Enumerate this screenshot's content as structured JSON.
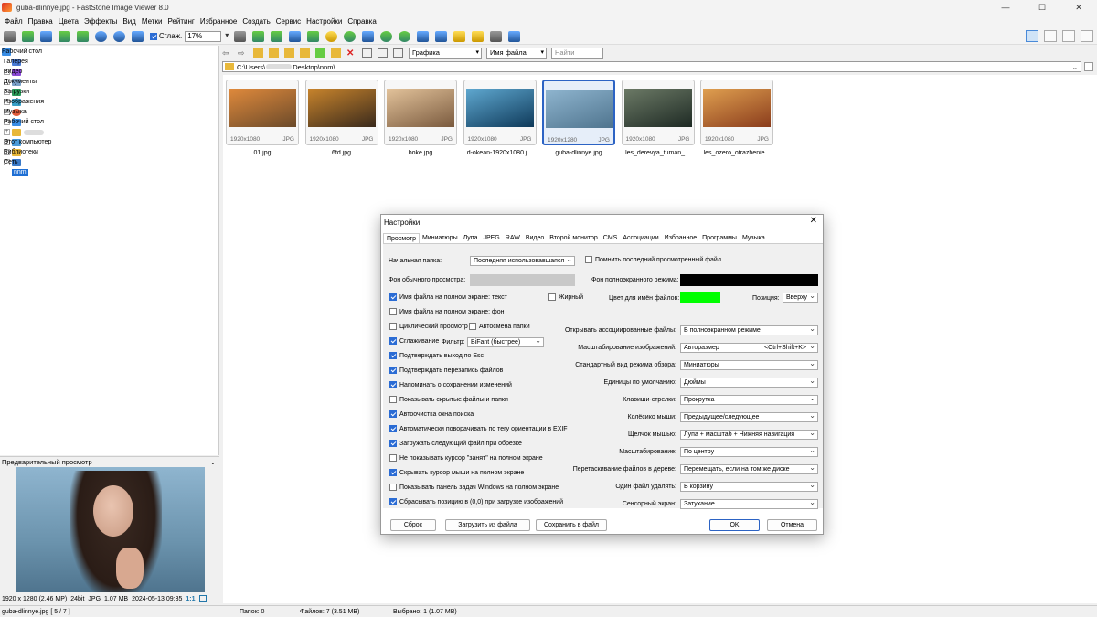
{
  "window": {
    "title": "guba-dlinnye.jpg  -  FastStone Image Viewer 8.0",
    "min": "—",
    "max": "☐",
    "close": "✕"
  },
  "menu": [
    "Файл",
    "Правка",
    "Цвета",
    "Эффекты",
    "Вид",
    "Метки",
    "Рейтинг",
    "Избранное",
    "Создать",
    "Сервис",
    "Настройки",
    "Справка"
  ],
  "toolbar": {
    "smooth_label": "Сглаж.",
    "zoom": "17%"
  },
  "tree": [
    {
      "label": "Рабочий стол"
    },
    {
      "label": "Галерея"
    },
    {
      "label": "Видео"
    },
    {
      "label": "Документы"
    },
    {
      "label": "Загрузки"
    },
    {
      "label": "Изображения"
    },
    {
      "label": "Музыка"
    },
    {
      "label": "Рабочий стол"
    },
    {
      "label": ""
    },
    {
      "label": "Этот компьютер"
    },
    {
      "label": "Библиотеки"
    },
    {
      "label": "Сеть"
    },
    {
      "label": "nnm"
    }
  ],
  "filters": {
    "type": "Графика",
    "sort": "Имя файла",
    "search_placeholder": "Найти"
  },
  "address": {
    "prefix": "C:\\Users\\",
    "suffix": "Desktop\\nnm\\"
  },
  "thumbs": [
    {
      "name": "01.jpg",
      "size": "1920x1080",
      "ext": "JPG",
      "c1": "#6b4a2a",
      "c2": "#e08a3c"
    },
    {
      "name": "6fd.jpg",
      "size": "1920x1080",
      "ext": "JPG",
      "c1": "#3a2a1c",
      "c2": "#c8842c"
    },
    {
      "name": "boke.jpg",
      "size": "1920x1080",
      "ext": "JPG",
      "c1": "#7a5a3e",
      "c2": "#e3c39b"
    },
    {
      "name": "d-okean-1920x1080.j...",
      "size": "1920x1080",
      "ext": "JPG",
      "c1": "#0f3a5a",
      "c2": "#5fa8d0"
    },
    {
      "name": "guba-dlinnye.jpg",
      "size": "1920x1280",
      "ext": "JPG",
      "c1": "#4f748e",
      "c2": "#8fb5cf"
    },
    {
      "name": "les_derevya_tuman_...",
      "size": "1920x1080",
      "ext": "JPG",
      "c1": "#1e2a24",
      "c2": "#6c7a66"
    },
    {
      "name": "les_ozero_otrazhenie...",
      "size": "1920x1080",
      "ext": "JPG",
      "c1": "#8a3c1c",
      "c2": "#e0a050"
    }
  ],
  "preview": {
    "header": "Предварительный просмотр",
    "chevron": "⌄"
  },
  "imginfo": {
    "dims": "1920 x 1280 (2.46 MP)",
    "depth": "24bit",
    "format": "JPG",
    "size": "1.07 MB",
    "date": "2024-05-13 09:35",
    "ratio": "1:1"
  },
  "status": {
    "file": "guba-dlinnye.jpg [ 5 / 7 ]",
    "folders": "Папок: 0",
    "files": "Файлов: 7 (3.51 MB)",
    "selected": "Выбрано: 1 (1.07 MB)"
  },
  "dialog": {
    "title": "Настройки",
    "close": "✕",
    "tabs": [
      "Просмотр",
      "Миниатюры",
      "Лупа",
      "JPEG",
      "RAW",
      "Видео",
      "Второй монитор",
      "CMS",
      "Ассоциации",
      "Избранное",
      "Программы",
      "Музыка"
    ],
    "start_folder_label": "Начальная папка:",
    "start_folder_value": "Последняя использовавшаяся",
    "remember_last": "Помнить последний просмотренный файл",
    "bg_normal_label": "Фон обычного просмотра:",
    "bg_normal_color": "#c8c8c8",
    "bg_full_label": "Фон полноэкранного режима:",
    "bg_full_color": "#000000",
    "filename_color_label": "Цвет для имён файлов:",
    "filename_color": "#00ff00",
    "position_label": "Позиция:",
    "position_value": "Вверху",
    "bold_label": "Жирный",
    "left_checks": [
      {
        "label": "Имя файла на полном экране: текст",
        "on": true
      },
      {
        "label": "Имя файла на полном экране: фон",
        "on": false
      },
      {
        "label": "Циклический просмотр",
        "on": false
      },
      {
        "label": "Сглаживание",
        "on": true
      },
      {
        "label": "Подтверждать выход по Esc",
        "on": true
      },
      {
        "label": "Подтверждать перезапись файлов",
        "on": true
      },
      {
        "label": "Напоминать о сохранении изменений",
        "on": true
      },
      {
        "label": "Показывать скрытые файлы и папки",
        "on": false
      },
      {
        "label": "Автоочистка окна поиска",
        "on": true
      },
      {
        "label": "Автоматически поворачивать по тегу ориентации в EXIF",
        "on": true
      },
      {
        "label": "Загружать следующий файл при обрезке",
        "on": true
      },
      {
        "label": "Не показывать курсор \"занят\" на полном экране",
        "on": false
      },
      {
        "label": "Скрывать курсор мыши на полном экране",
        "on": true
      },
      {
        "label": "Показывать панель задач Windows на полном экране",
        "on": false
      },
      {
        "label": "Сбрасывать позицию в (0,0) при загрузке изображений",
        "on": true
      }
    ],
    "autoswap_label": "Автосмена папки",
    "filter_label": "Фильтр:",
    "filter_value": "BiFant (быстрее)",
    "right_rows": [
      {
        "label": "Открывать ассоциированные файлы:",
        "value": "В полноэкранном режиме"
      },
      {
        "label": "Масштабирование изображений:",
        "value": "Авторазмер",
        "extra": "<Ctrl+Shift+K>"
      },
      {
        "label": "Стандартный вид режима обзора:",
        "value": "Миниатюры"
      },
      {
        "label": "Единицы по умолчанию:",
        "value": "Дюймы"
      },
      {
        "label": "Клавиши-стрелки:",
        "value": "Прокрутка"
      },
      {
        "label": "Колёсико мыши:",
        "value": "Предыдущее/следующее"
      },
      {
        "label": "Щелчок мышью:",
        "value": "Лупа + масштаб + Нижняя навигация"
      },
      {
        "label": "Масштабирование:",
        "value": "По центру"
      },
      {
        "label": "Перетаскивание файлов в дереве:",
        "value": "Перемещать, если на том же диске"
      },
      {
        "label": "Один файл удалять:",
        "value": "В корзину"
      },
      {
        "label": "Сенсорный экран:",
        "value": "Затухание"
      }
    ],
    "buttons": {
      "reset": "Сброс",
      "load": "Загрузить из файла",
      "save": "Сохранить в файл",
      "ok": "OK",
      "cancel": "Отмена"
    }
  }
}
